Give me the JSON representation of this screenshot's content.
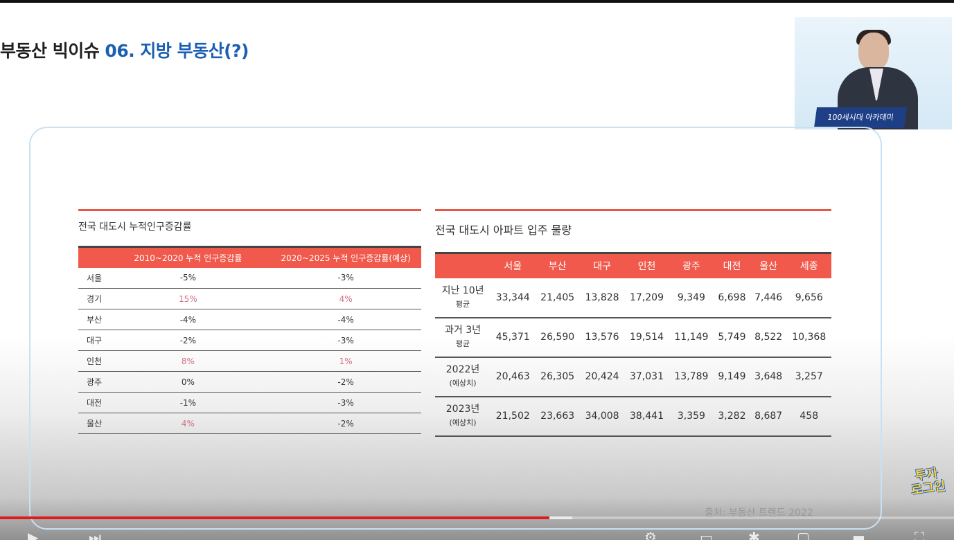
{
  "slide": {
    "title_prefix": "부동산 빅이슈 ",
    "title_accent": "06. 지방 부동산(?)"
  },
  "webcam": {
    "desk_text": "100세시대 아카데미"
  },
  "left_table": {
    "caption": "전국 대도시 누적인구증감률",
    "headers": [
      "",
      "2010~2020 누적 인구증감률",
      "2020~2025 누적 인구증감률(예상)"
    ],
    "rows": [
      {
        "city": "서울",
        "a": "-5%",
        "b": "-3%"
      },
      {
        "city": "경기",
        "a": "15%",
        "b": "4%"
      },
      {
        "city": "부산",
        "a": "-4%",
        "b": "-4%"
      },
      {
        "city": "대구",
        "a": "-2%",
        "b": "-3%"
      },
      {
        "city": "인천",
        "a": "8%",
        "b": "1%"
      },
      {
        "city": "광주",
        "a": "0%",
        "b": "-2%"
      },
      {
        "city": "대전",
        "a": "-1%",
        "b": "-3%"
      },
      {
        "city": "울산",
        "a": "4%",
        "b": "-2%"
      }
    ],
    "positive_color": "#d16f86"
  },
  "right_table": {
    "caption": "전국 대도시 아파트 입주 물량",
    "headers": [
      "",
      "서울",
      "부산",
      "대구",
      "인천",
      "광주",
      "대전",
      "울산",
      "세종"
    ],
    "rows": [
      {
        "label": "지난 10년",
        "sub": "평균",
        "values": [
          "33,344",
          "21,405",
          "13,828",
          "17,209",
          "9,349",
          "6,698",
          "7,446",
          "9,656"
        ]
      },
      {
        "label": "과거 3년",
        "sub": "평균",
        "values": [
          "45,371",
          "26,590",
          "13,576",
          "19,514",
          "11,149",
          "5,749",
          "8,522",
          "10,368"
        ]
      },
      {
        "label": "2022년",
        "sub": "(예상치)",
        "values": [
          "20,463",
          "26,305",
          "20,424",
          "37,031",
          "13,789",
          "9,149",
          "3,648",
          "3,257"
        ]
      },
      {
        "label": "2023년",
        "sub": "(예상치)",
        "values": [
          "21,502",
          "23,663",
          "34,008",
          "38,441",
          "3,359",
          "3,282",
          "8,687",
          "458"
        ]
      }
    ]
  },
  "source_text": "출처: 부동산 트렌드 2022",
  "logo_text": "투자\n로그인",
  "video": {
    "played_fraction": 0.576,
    "buffered_fraction": 0.6,
    "accent_color": "#e01b1b",
    "control_icons": [
      "play-icon",
      "next-icon",
      "volume-icon",
      "settings-icon",
      "subtitles-icon",
      "miniplayer-icon",
      "theater-icon",
      "fullscreen-icon"
    ]
  }
}
